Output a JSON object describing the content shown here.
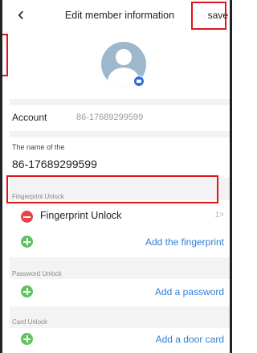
{
  "nav": {
    "back_icon": "chevron-left-icon",
    "title": "Edit member information",
    "save_label": "save"
  },
  "avatar": {
    "icon": "user-avatar-icon",
    "badge_icon": "camera-icon"
  },
  "account": {
    "label": "Account",
    "value": "86-17689299599"
  },
  "name": {
    "caption": "The name of the",
    "value": "86-17689299599"
  },
  "fingerprint": {
    "caption": "Fingerprint Unlock",
    "item_label": "Fingerprint Unlock",
    "item_count": "1>",
    "add_label": "Add the fingerprint"
  },
  "password": {
    "caption": "Password Unlock",
    "add_label": "Add a password"
  },
  "card": {
    "caption": "Card Unlock",
    "add_label": "Add a door card"
  },
  "colors": {
    "highlight": "#e0141b",
    "link": "#2f7fd9",
    "add": "#5fc35f",
    "remove": "#e64545"
  }
}
